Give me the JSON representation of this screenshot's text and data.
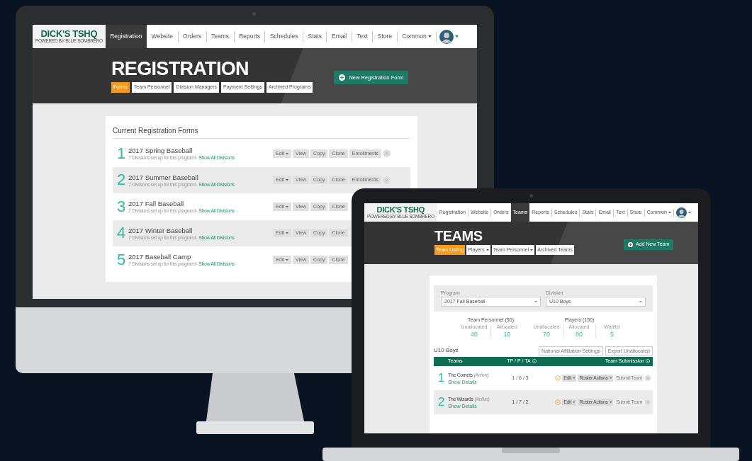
{
  "desktop": {
    "logo": {
      "wordmark": "DICK'S TSHQ",
      "tagline": "POWERED BY BLUE SOMBRERO"
    },
    "nav": [
      {
        "label": "Registration",
        "selected": true,
        "dropdown": false
      },
      {
        "label": "Website",
        "selected": false,
        "dropdown": false
      },
      {
        "label": "Orders",
        "selected": false,
        "dropdown": false
      },
      {
        "label": "Teams",
        "selected": false,
        "dropdown": false
      },
      {
        "label": "Reports",
        "selected": false,
        "dropdown": false
      },
      {
        "label": "Schedules",
        "selected": false,
        "dropdown": false
      },
      {
        "label": "Stats",
        "selected": false,
        "dropdown": false
      },
      {
        "label": "Email",
        "selected": false,
        "dropdown": false
      },
      {
        "label": "Text",
        "selected": false,
        "dropdown": false
      },
      {
        "label": "Store",
        "selected": false,
        "dropdown": false
      },
      {
        "label": "Common",
        "selected": false,
        "dropdown": true
      }
    ],
    "page_title": "REGISTRATION",
    "subtabs": [
      {
        "label": "Forms",
        "selected": true,
        "dropdown": false
      },
      {
        "label": "Team Personnel",
        "selected": false,
        "dropdown": false
      },
      {
        "label": "Division Managers",
        "selected": false,
        "dropdown": false
      },
      {
        "label": "Payment Settings",
        "selected": false,
        "dropdown": false
      },
      {
        "label": "Archived Programs",
        "selected": false,
        "dropdown": false
      }
    ],
    "primary_button": "New Registration Form",
    "card_title": "Current Registration Forms",
    "forms": [
      {
        "number": "1",
        "name": "2017 Spring Baseball",
        "note": "7 Divisions set up for this program!-",
        "link": "Show All Divisions",
        "buttons": [
          {
            "kind": "dropdown",
            "label": "Edit"
          },
          {
            "kind": "plain",
            "label": "View"
          },
          {
            "kind": "plain",
            "label": "Copy"
          },
          {
            "kind": "plain",
            "label": "Clone"
          },
          {
            "kind": "plain",
            "label": "Enrollments"
          },
          {
            "kind": "remove"
          }
        ]
      },
      {
        "number": "2",
        "name": "2017 Summer Baseball",
        "note": "7 Divisions set up for this program!-",
        "link": "Show All Divisions",
        "buttons": [
          {
            "kind": "dropdown",
            "label": "Edit"
          },
          {
            "kind": "plain",
            "label": "View"
          },
          {
            "kind": "plain",
            "label": "Copy"
          },
          {
            "kind": "plain",
            "label": "Clone"
          },
          {
            "kind": "plain",
            "label": "Enrollments"
          },
          {
            "kind": "remove"
          }
        ]
      },
      {
        "number": "3",
        "name": "2017 Fall Baseball",
        "note": "7 Divisions set up for this program!-",
        "link": "Show All Divisions",
        "buttons": [
          {
            "kind": "dropdown",
            "label": "Edit"
          },
          {
            "kind": "plain",
            "label": "View"
          },
          {
            "kind": "plain",
            "label": "Copy"
          },
          {
            "kind": "plain",
            "label": "Clone"
          }
        ]
      },
      {
        "number": "4",
        "name": "2017 Winter Baseball",
        "note": "7 Divisions set up for this program!-",
        "link": "Show All Divisions",
        "buttons": [
          {
            "kind": "dropdown",
            "label": "Edit"
          },
          {
            "kind": "plain",
            "label": "View"
          },
          {
            "kind": "plain",
            "label": "Copy"
          },
          {
            "kind": "plain",
            "label": "Clone"
          }
        ]
      },
      {
        "number": "5",
        "name": "2017 Baseball Camp",
        "note": "7 Divisions set up for this program!-",
        "link": "Show All Divisions",
        "buttons": [
          {
            "kind": "dropdown",
            "label": "Edit"
          },
          {
            "kind": "plain",
            "label": "View"
          },
          {
            "kind": "plain",
            "label": "Copy"
          },
          {
            "kind": "plain",
            "label": "Clone"
          }
        ]
      }
    ]
  },
  "laptop": {
    "logo": {
      "wordmark": "DICK'S TSHQ",
      "tagline": "POWERED BY BLUE SOMBRERO"
    },
    "nav": [
      {
        "label": "Registration",
        "selected": false,
        "dropdown": false
      },
      {
        "label": "Website",
        "selected": false,
        "dropdown": false
      },
      {
        "label": "Orders",
        "selected": false,
        "dropdown": false
      },
      {
        "label": "Teams",
        "selected": true,
        "dropdown": false
      },
      {
        "label": "Reports",
        "selected": false,
        "dropdown": false
      },
      {
        "label": "Schedules",
        "selected": false,
        "dropdown": false
      },
      {
        "label": "Stats",
        "selected": false,
        "dropdown": false
      },
      {
        "label": "Email",
        "selected": false,
        "dropdown": false
      },
      {
        "label": "Text",
        "selected": false,
        "dropdown": false
      },
      {
        "label": "Store",
        "selected": false,
        "dropdown": false
      },
      {
        "label": "Common",
        "selected": false,
        "dropdown": true
      }
    ],
    "page_title": "TEAMS",
    "subtabs": [
      {
        "label": "Team Listing",
        "selected": true,
        "dropdown": false
      },
      {
        "label": "Players",
        "selected": false,
        "dropdown": true
      },
      {
        "label": "Team Personnel",
        "selected": false,
        "dropdown": true
      },
      {
        "label": "Archived Teams",
        "selected": false,
        "dropdown": false
      }
    ],
    "primary_button": "Add New Team",
    "filters": [
      {
        "label": "Program",
        "value": "2017 Fall Baseball"
      },
      {
        "label": "Division",
        "value": "U10 Boys"
      }
    ],
    "stat_groups": [
      {
        "title": "Team Personnel (50)",
        "stats": [
          {
            "label": "Unallocated",
            "value": "40"
          },
          {
            "label": "Allocated",
            "value": "10"
          }
        ]
      },
      {
        "title": "Players (150)",
        "stats": [
          {
            "label": "Unallocated",
            "value": "70"
          },
          {
            "label": "Allocated",
            "value": "80"
          },
          {
            "label": "Waitlist",
            "value": "5"
          }
        ]
      }
    ],
    "section_title": "U10 Boys",
    "section_buttons": [
      "National Affiliation Settings",
      "Export Unallocated"
    ],
    "table": {
      "columns": [
        {
          "label": "Teams",
          "info": false
        },
        {
          "label": "TP / P / TA",
          "info": true
        },
        {
          "label": "Team Submission",
          "info": true
        }
      ],
      "rows": [
        {
          "number": "1",
          "name": "The Comets",
          "status": "(Active)",
          "link": "Show Details",
          "counts": "1 / 6 / 3",
          "edit": "Edit",
          "roster": "Roster Actions",
          "submit": "Submit Team",
          "submit_disabled": true
        },
        {
          "number": "2",
          "name": "The Wizards",
          "status": "(Active)",
          "link": "Show Details",
          "counts": "1 / 7 / 2",
          "edit": "Edit",
          "roster": "Roster Actions",
          "submit": "Submit Team",
          "submit_disabled": true
        }
      ]
    }
  }
}
